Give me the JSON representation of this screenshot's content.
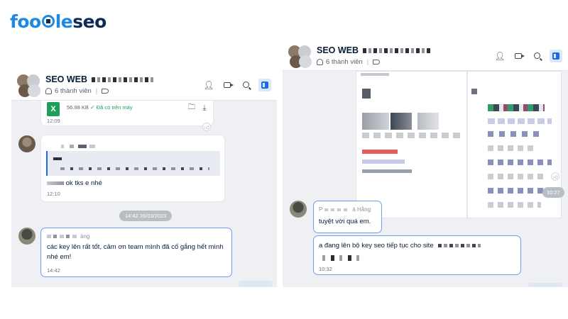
{
  "logo": {
    "part1": "foo",
    "part2": "le",
    "part3": "seo"
  },
  "left_panel": {
    "header": {
      "title": "SEO WEB",
      "members": "6 thành viên"
    },
    "file_message": {
      "icon": "X",
      "size": "56.98 KB",
      "status": "Đã có trên máy",
      "time": "12:09"
    },
    "reply_message": {
      "text": "ok tks e nhé",
      "time": "12:10"
    },
    "date_divider": "14:42 26/03/2023",
    "last_message": {
      "sender_suffix": "àng",
      "text": "các key lên rất tốt, cảm ơn team mình đã cố gắng hết mình nhé em!",
      "time": "14:42"
    }
  },
  "right_panel": {
    "header": {
      "title": "SEO WEB",
      "members": "6 thành viên"
    },
    "image_time": "10:27",
    "msg1": {
      "sender_prefix": "P",
      "sender_suffix": "à Hằng",
      "text": "tuyệt vời quá em."
    },
    "msg2": {
      "text": "a đang lên bộ key seo tiếp tục cho site",
      "time": "10:32"
    }
  },
  "icons": [
    "add-member-icon",
    "video-call-icon",
    "search-icon",
    "toggle-panel-icon",
    "person-icon",
    "tag-icon",
    "download-icon",
    "folder-icon",
    "thumbs-up-icon"
  ]
}
